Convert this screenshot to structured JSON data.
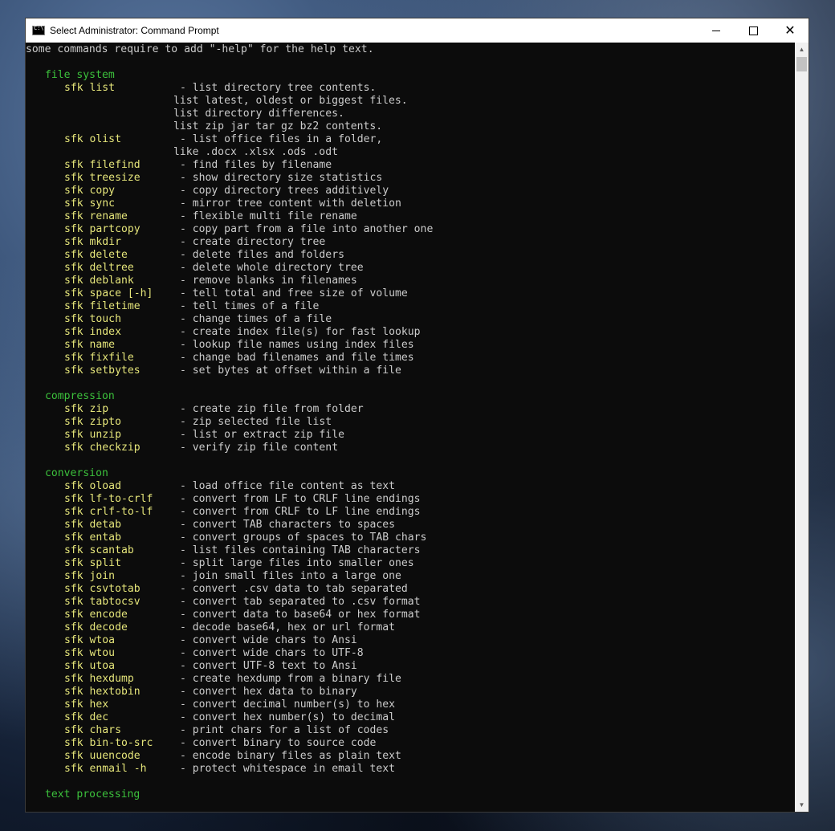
{
  "window": {
    "title": "Select Administrator: Command Prompt",
    "minimize_glyph": "—",
    "maximize_glyph": "☐",
    "close_glyph": "✕"
  },
  "console": {
    "intro": "some commands require to add \"-help\" for the help text.",
    "sections": [
      {
        "header": "file system",
        "entries": [
          {
            "cmd": "sfk list",
            "desc": "- list directory tree contents.",
            "cont": [
              "list latest, oldest or biggest files.",
              "list directory differences.",
              "list zip jar tar gz bz2 contents."
            ]
          },
          {
            "cmd": "sfk olist",
            "desc": "- list office files in a folder,",
            "cont": [
              "like .docx .xlsx .ods .odt"
            ]
          },
          {
            "cmd": "sfk filefind",
            "desc": "- find files by filename"
          },
          {
            "cmd": "sfk treesize",
            "desc": "- show directory size statistics"
          },
          {
            "cmd": "sfk copy",
            "desc": "- copy directory trees additively"
          },
          {
            "cmd": "sfk sync",
            "desc": "- mirror tree content with deletion"
          },
          {
            "cmd": "sfk rename",
            "desc": "- flexible multi file rename"
          },
          {
            "cmd": "sfk partcopy",
            "desc": "- copy part from a file into another one"
          },
          {
            "cmd": "sfk mkdir",
            "desc": "- create directory tree"
          },
          {
            "cmd": "sfk delete",
            "desc": "- delete files and folders"
          },
          {
            "cmd": "sfk deltree",
            "desc": "- delete whole directory tree"
          },
          {
            "cmd": "sfk deblank",
            "desc": "- remove blanks in filenames"
          },
          {
            "cmd": "sfk space [-h]",
            "desc": "- tell total and free size of volume"
          },
          {
            "cmd": "sfk filetime",
            "desc": "- tell times of a file"
          },
          {
            "cmd": "sfk touch",
            "desc": "- change times of a file"
          },
          {
            "cmd": "sfk index",
            "desc": "- create index file(s) for fast lookup"
          },
          {
            "cmd": "sfk name",
            "desc": "- lookup file names using index files"
          },
          {
            "cmd": "sfk fixfile",
            "desc": "- change bad filenames and file times"
          },
          {
            "cmd": "sfk setbytes",
            "desc": "- set bytes at offset within a file"
          }
        ]
      },
      {
        "header": "compression",
        "entries": [
          {
            "cmd": "sfk zip",
            "desc": "- create zip file from folder"
          },
          {
            "cmd": "sfk zipto",
            "desc": "- zip selected file list"
          },
          {
            "cmd": "sfk unzip",
            "desc": "- list or extract zip file"
          },
          {
            "cmd": "sfk checkzip",
            "desc": "- verify zip file content"
          }
        ]
      },
      {
        "header": "conversion",
        "entries": [
          {
            "cmd": "sfk oload",
            "desc": "- load office file content as text"
          },
          {
            "cmd": "sfk lf-to-crlf",
            "desc": "- convert from LF to CRLF line endings"
          },
          {
            "cmd": "sfk crlf-to-lf",
            "desc": "- convert from CRLF to LF line endings"
          },
          {
            "cmd": "sfk detab",
            "desc": "- convert TAB characters to spaces"
          },
          {
            "cmd": "sfk entab",
            "desc": "- convert groups of spaces to TAB chars"
          },
          {
            "cmd": "sfk scantab",
            "desc": "- list files containing TAB characters"
          },
          {
            "cmd": "sfk split",
            "desc": "- split large files into smaller ones"
          },
          {
            "cmd": "sfk join",
            "desc": "- join small files into a large one"
          },
          {
            "cmd": "sfk csvtotab",
            "desc": "- convert .csv data to tab separated"
          },
          {
            "cmd": "sfk tabtocsv",
            "desc": "- convert tab separated to .csv format"
          },
          {
            "cmd": "sfk encode",
            "desc": "- convert data to base64 or hex format"
          },
          {
            "cmd": "sfk decode",
            "desc": "- decode base64, hex or url format"
          },
          {
            "cmd": "sfk wtoa",
            "desc": "- convert wide chars to Ansi"
          },
          {
            "cmd": "sfk wtou",
            "desc": "- convert wide chars to UTF-8"
          },
          {
            "cmd": "sfk utoa",
            "desc": "- convert UTF-8 text to Ansi"
          },
          {
            "cmd": "sfk hexdump",
            "desc": "- create hexdump from a binary file"
          },
          {
            "cmd": "sfk hextobin",
            "desc": "- convert hex data to binary"
          },
          {
            "cmd": "sfk hex",
            "desc": "- convert decimal number(s) to hex"
          },
          {
            "cmd": "sfk dec",
            "desc": "- convert hex number(s) to decimal"
          },
          {
            "cmd": "sfk chars",
            "desc": "- print chars for a list of codes"
          },
          {
            "cmd": "sfk bin-to-src",
            "desc": "- convert binary to source code"
          },
          {
            "cmd": "sfk uuencode",
            "desc": "- encode binary files as plain text"
          },
          {
            "cmd": "sfk enmail -h",
            "desc": "- protect whitespace in email text"
          }
        ]
      },
      {
        "header": "text processing",
        "entries": []
      }
    ]
  },
  "colors": {
    "background": "#0c0c0c",
    "header": "#3cc13c",
    "command": "#e5e57a",
    "text": "#cccccc"
  }
}
